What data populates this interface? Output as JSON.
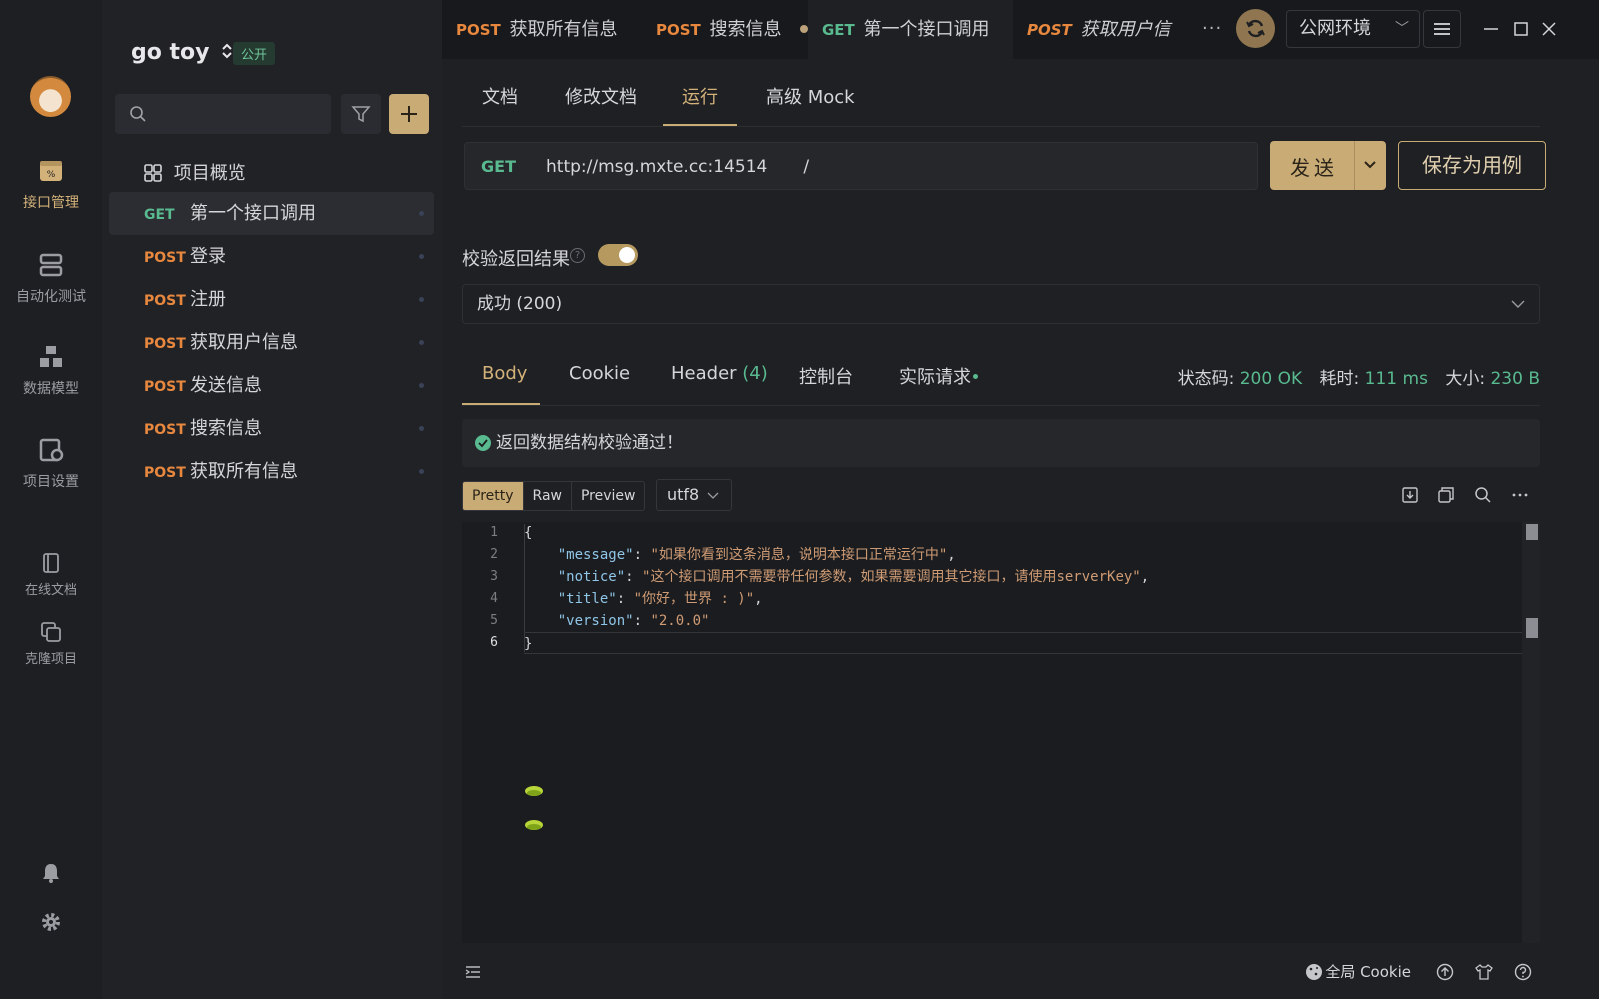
{
  "rail": {
    "items": [
      {
        "label": "接口管理",
        "icon": "api-management-icon"
      },
      {
        "label": "自动化测试",
        "icon": "automation-test-icon"
      },
      {
        "label": "数据模型",
        "icon": "data-model-icon"
      },
      {
        "label": "项目设置",
        "icon": "project-settings-icon"
      },
      {
        "label": "在线文档",
        "icon": "online-docs-icon"
      },
      {
        "label": "克隆项目",
        "icon": "clone-project-icon"
      }
    ]
  },
  "sidebar": {
    "project_name": "go toy",
    "visibility": "公开",
    "overview": "项目概览",
    "apis": [
      {
        "method": "GET",
        "name": "第一个接口调用"
      },
      {
        "method": "POST",
        "name": "登录"
      },
      {
        "method": "POST",
        "name": "注册"
      },
      {
        "method": "POST",
        "name": "获取用户信息"
      },
      {
        "method": "POST",
        "name": "发送信息"
      },
      {
        "method": "POST",
        "name": "搜索信息"
      },
      {
        "method": "POST",
        "name": "获取所有信息"
      }
    ]
  },
  "tabs": [
    {
      "method": "POST",
      "name": "获取所有信息"
    },
    {
      "method": "POST",
      "name": "搜索信息"
    },
    {
      "method": "GET",
      "name": "第一个接口调用"
    },
    {
      "method": "POST",
      "name": "获取用户信息"
    }
  ],
  "tabbar": {
    "more": "···",
    "env": "公网环境"
  },
  "subtabs": [
    "文档",
    "修改文档",
    "运行",
    "高级 Mock"
  ],
  "request": {
    "method": "GET",
    "url_base": "http://msg.mxte.cc:14514",
    "url_path": "/",
    "send_label": "发送",
    "save_label": "保存为用例"
  },
  "validation": {
    "label": "校验返回结果",
    "enabled": true,
    "selected_response": "成功 (200)"
  },
  "response_tabs": {
    "body": "Body",
    "cookie": "Cookie",
    "header": "Header",
    "header_count": "(4)",
    "console": "控制台",
    "actual": "实际请求"
  },
  "stats": {
    "status_label": "状态码:",
    "status_value": "200 OK",
    "time_label": "耗时:",
    "time_value": "111 ms",
    "size_label": "大小:",
    "size_value": "230 B"
  },
  "banner": "返回数据结构校验通过！",
  "format": {
    "pretty": "Pretty",
    "raw": "Raw",
    "preview": "Preview",
    "encoding": "utf8"
  },
  "code": {
    "line_numbers": [
      "1",
      "2",
      "3",
      "4",
      "5",
      "6"
    ],
    "open_brace": "{",
    "close_brace": "}",
    "message_key": "\"message\"",
    "message_val": "\"如果你看到这条消息，说明本接口正常运行中\"",
    "notice_key": "\"notice\"",
    "notice_val": "\"这个接口调用不需要带任何参数，如果需要调用其它接口，请使用serverKey\"",
    "title_key": "\"title\"",
    "title_val": "\"你好，世界 : )\"",
    "version_key": "\"version\"",
    "version_val": "\"2.0.0\""
  },
  "statusbar": {
    "cookie": "全局 Cookie"
  },
  "colors": {
    "accent": "#c9ab76",
    "get": "#59b98f",
    "post": "#e7883e"
  }
}
